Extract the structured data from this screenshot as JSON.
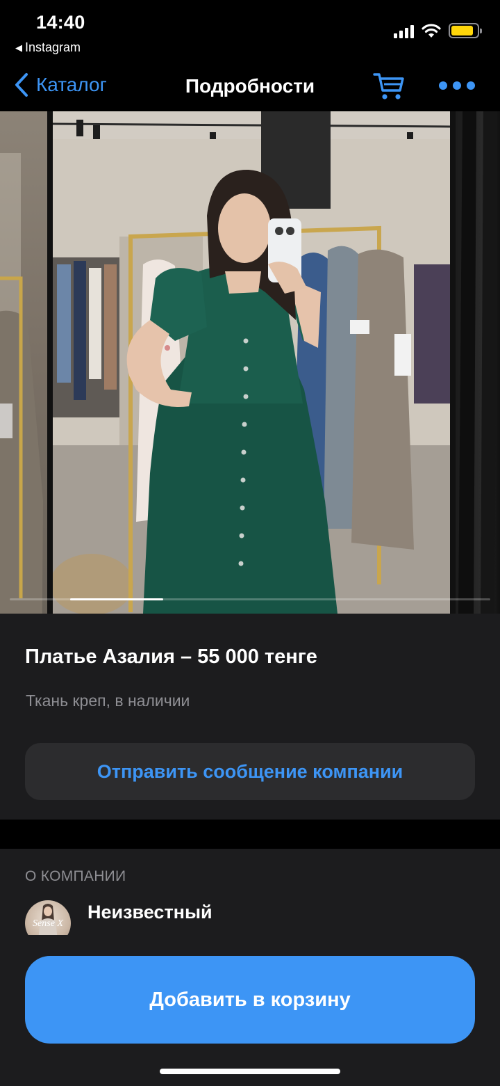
{
  "status_bar": {
    "time": "14:40",
    "back_app": "Instagram",
    "battery_level": 0.85,
    "battery_color": "#ffd60a",
    "signal_icon": "cellular-signal-icon",
    "wifi_icon": "wifi-icon"
  },
  "nav": {
    "back_label": "Каталог",
    "title": "Подробности",
    "cart_icon": "cart-icon",
    "more_icon": "more-dots-icon",
    "accent_color": "#3d95f5"
  },
  "gallery": {
    "image_count": 4,
    "active_index": 1
  },
  "product": {
    "title": "Платье Азалия – 55 000 тенге",
    "description": "Ткань креп, в наличии",
    "message_button": "Отправить сообщение компании"
  },
  "company": {
    "header": "О КОМПАНИИ",
    "name": "Неизвестный",
    "avatar_text": "Sense X"
  },
  "actions": {
    "add_to_cart": "Добавить в корзину"
  }
}
